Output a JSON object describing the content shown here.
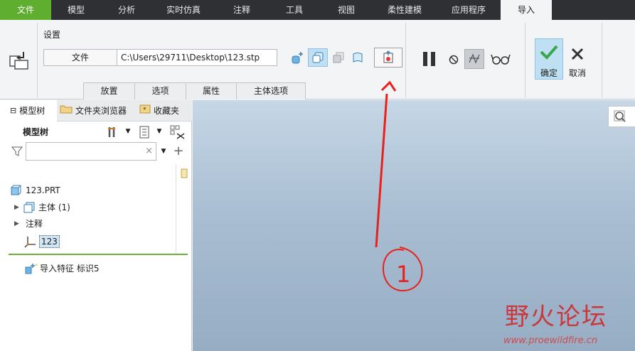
{
  "ribbon_tabs": [
    "文件",
    "模型",
    "分析",
    "实时仿真",
    "注释",
    "工具",
    "视图",
    "柔性建模",
    "应用程序",
    "导入"
  ],
  "settings": {
    "group_label": "设置",
    "file_label": "文件",
    "file_path": "C:\\Users\\29711\\Desktop\\123.stp"
  },
  "sub_tabs": [
    "放置",
    "选项",
    "属性",
    "主体选项"
  ],
  "actions": {
    "ok": "确定",
    "cancel": "取消"
  },
  "panel_tabs": [
    "模型树",
    "文件夹浏览器",
    "收藏夹"
  ],
  "tree": {
    "title": "模型树",
    "filter_placeholder": "",
    "items": [
      {
        "label": "123.PRT"
      },
      {
        "label": "主体 (1)"
      },
      {
        "label": "注释"
      },
      {
        "label": "123"
      },
      {
        "label": "导入特征 标识5"
      }
    ]
  },
  "annotation": {
    "number": "1"
  },
  "watermark": {
    "title": "野火论坛",
    "url": "www.proewildfire.cn"
  },
  "colors": {
    "file_tab": "#5fae2f",
    "active_toggle": "#bfe0f3",
    "annotation": "#e8211d",
    "divider": "#6ab23a"
  }
}
